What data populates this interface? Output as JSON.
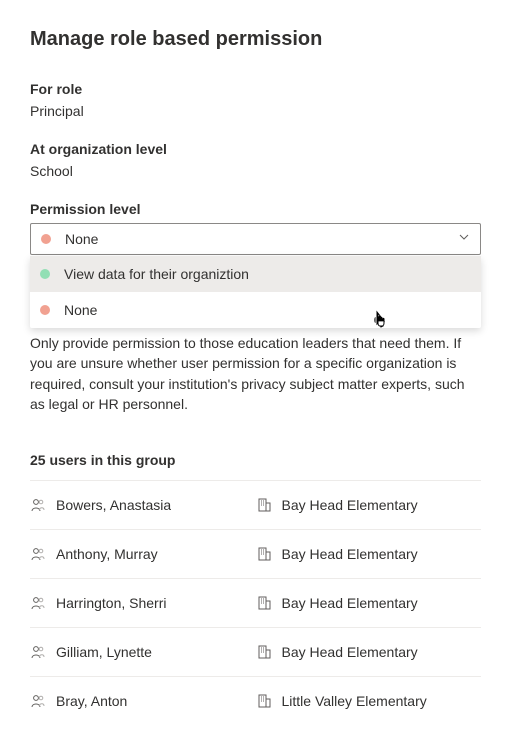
{
  "title": "Manage role based permission",
  "roleField": {
    "label": "For role",
    "value": "Principal"
  },
  "orgField": {
    "label": "At organization level",
    "value": "School"
  },
  "permissionField": {
    "label": "Permission level",
    "selected": "None",
    "options": {
      "view": "View data for their organiztion",
      "none": "None"
    }
  },
  "helpText": "Only provide permission to those education leaders that need them. If you are unsure whether user permission for a specific organization is required, consult your institution's privacy subject matter experts, such as legal or HR personnel.",
  "usersHeading": "25 users in this group",
  "users": [
    {
      "name": "Bowers, Anastasia",
      "org": "Bay Head Elementary"
    },
    {
      "name": "Anthony, Murray",
      "org": "Bay Head Elementary"
    },
    {
      "name": "Harrington, Sherri",
      "org": "Bay Head Elementary"
    },
    {
      "name": "Gilliam, Lynette",
      "org": "Bay Head Elementary"
    },
    {
      "name": "Bray, Anton",
      "org": "Little Valley Elementary"
    }
  ],
  "icons": {
    "person": "person-icon",
    "building": "building-icon",
    "chevron": "chevron-down-icon",
    "pointer": "pointer-cursor-icon"
  }
}
